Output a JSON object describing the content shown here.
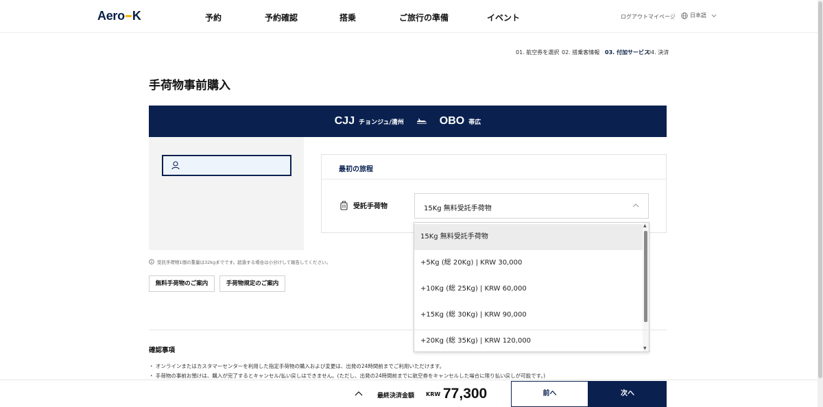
{
  "header": {
    "logo": "Aero",
    "logo_k": "K",
    "nav": [
      "予約",
      "予約確認",
      "搭乗",
      "ご旅行の準備",
      "イベント"
    ],
    "logout": "ログアウト",
    "mypage": "マイページ",
    "language": "日本語"
  },
  "steps": [
    "01. 航空券を選択",
    "02. 搭乗客情報",
    "03. 付加サービス",
    "04. 決済"
  ],
  "active_step": 2,
  "page_title": "手荷物事前購入",
  "route": {
    "from_code": "CJJ",
    "from_city": "チョンジュ/清州",
    "to_code": "OBO",
    "to_city": "帯広"
  },
  "itinerary_title": "最初の旅程",
  "baggage": {
    "label": "受託手荷物",
    "selected": "15Kg 無料受託手荷物",
    "options": [
      "15Kg 無料受託手荷物",
      "+5Kg (総 20Kg) | KRW 30,000",
      "+10Kg (総 25Kg) | KRW 60,000",
      "+15Kg (総 30Kg) | KRW 90,000",
      "+20Kg (総 35Kg) | KRW 120,000"
    ]
  },
  "note": "受託手荷物1個の重量は32kgまでです。超過する場合は小分けして報告してください。",
  "buttons": {
    "free_baggage_info": "無料手荷物のご案内",
    "baggage_rules": "手荷物規定のご案内",
    "prev": "前へ",
    "next": "次へ"
  },
  "confirm": {
    "title": "確認事項",
    "items": [
      "・ オンラインまたはカスタマーセンターを利用した指定手荷物の購入および変更は、出発の24時間前までご利用いただけます。",
      "・ 手荷物の事前お預けは、購入が完了するとキャンセル/払い戻しはできません。(ただし、出発の24時間前までに航空券をキャンセルした場合に限り払い戻しが可能です。)"
    ]
  },
  "footer": {
    "total_label": "最終決済金額",
    "currency": "KRW",
    "amount": "77,300"
  },
  "colors": {
    "navy": "#0a2150",
    "accent": "#f7b500"
  }
}
